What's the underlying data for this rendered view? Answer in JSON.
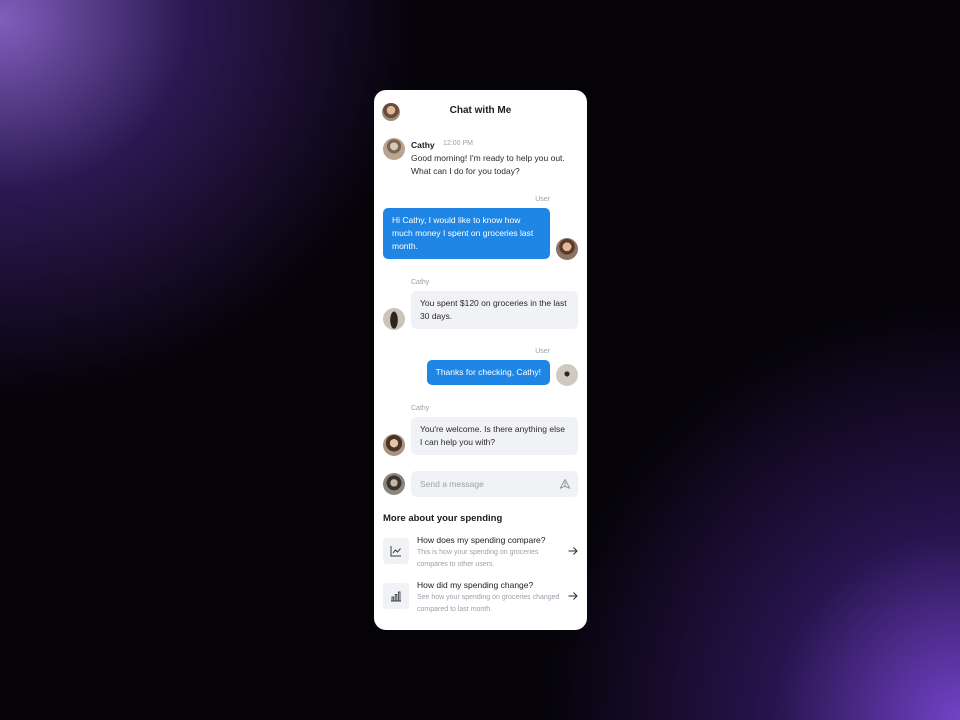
{
  "header": {
    "title": "Chat with Me"
  },
  "messages": {
    "m1": {
      "sender": "Cathy",
      "time": "12:00 PM",
      "text": "Good morning! I'm ready to help you out. What can I do for you today?"
    },
    "m2": {
      "sender": "User",
      "text": "Hi Cathy, I would like to know how much money I spent on groceries last month."
    },
    "m3": {
      "sender": "Cathy",
      "text": "You spent $120 on groceries in the last 30 days."
    },
    "m4": {
      "sender": "User",
      "text": "Thanks for checking, Cathy!"
    },
    "m5": {
      "sender": "Cathy",
      "text": "You're welcome. Is there anything else I can help you with?"
    }
  },
  "composer": {
    "placeholder": "Send a message"
  },
  "spending": {
    "title": "More about your spending",
    "items": [
      {
        "title": "How does my spending compare?",
        "description": "This is how your spending on groceries compares to other users.",
        "icon": "line-chart-icon"
      },
      {
        "title": "How did my spending change?",
        "description": "See how your spending on groceries changed compared to last month.",
        "icon": "bar-chart-icon"
      }
    ]
  },
  "colors": {
    "accent": "#1f86e6",
    "bubble_gray": "#f1f2f5",
    "card": "#ffffff"
  }
}
